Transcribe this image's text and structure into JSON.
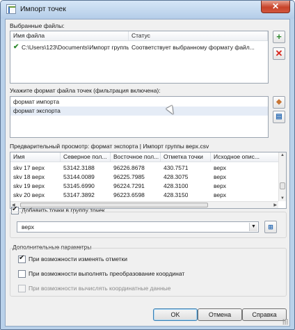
{
  "window": {
    "title": "Импорт точек",
    "close_glyph": "✕"
  },
  "selected_files": {
    "label": "Выбранные файлы:",
    "columns": [
      "Имя файла",
      "Статус"
    ],
    "rows": [
      {
        "name": "C:\\Users\\123\\Documents\\Импорт группы ...",
        "status": "Соответствует выбранному формату файл..."
      }
    ],
    "add_glyph": "+",
    "remove_glyph": "✕"
  },
  "format": {
    "label": "Укажите формат файла точек (фильтрация включена):",
    "items": [
      "формат импорта",
      "формат экспорта"
    ],
    "selected_index": 1
  },
  "preview": {
    "label": "Предварительный просмотр: формат экспорта | Импорт группы верх.csv",
    "columns": [
      "Имя",
      "Северное пол...",
      "Восточное пол...",
      "Отметка точки",
      "Исходное опис..."
    ],
    "rows": [
      [
        "skv 17 верх",
        "53142.3188",
        "96226.8678",
        "430.7571",
        "верх"
      ],
      [
        "skv 18 верх",
        "53144.0089",
        "96225.7985",
        "428.3075",
        "верх"
      ],
      [
        "skv 19 верх",
        "53145.6990",
        "96224.7291",
        "428.3100",
        "верх"
      ],
      [
        "skv 20 верх",
        "53147.3892",
        "96223.6598",
        "428.3150",
        "верх"
      ]
    ]
  },
  "add_to_group": {
    "label": "Добавить точки в группу точек",
    "checked": true,
    "value": "верх"
  },
  "additional": {
    "label": "Дополнительные параметры",
    "options": [
      {
        "label": "При возможности изменять отметки",
        "checked": true,
        "enabled": true
      },
      {
        "label": "При возможности выполнять преобразование координат",
        "checked": false,
        "enabled": true
      },
      {
        "label": "При возможности вычислять координатные данные",
        "checked": false,
        "enabled": false
      }
    ]
  },
  "buttons": {
    "ok": "OK",
    "cancel": "Отмена",
    "help": "Справка"
  },
  "colors": {
    "accent": "#3399ff",
    "selection": "#e5ecf6",
    "delete": "#d8261c",
    "add": "#2f8a2f",
    "check": "#2f8a2f"
  },
  "icons": [
    "check-icon",
    "plus-icon",
    "delete-icon",
    "edit-format-icon",
    "manage-format-icon",
    "group-select-icon",
    "dropdown-arrow-icon"
  ]
}
